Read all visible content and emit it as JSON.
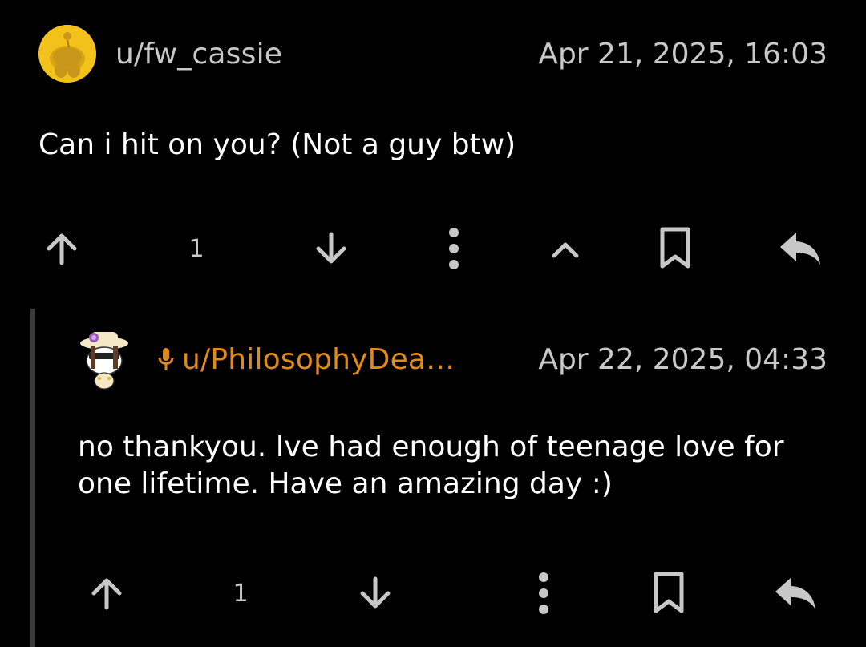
{
  "comments": [
    {
      "username": "u/fw_cassie",
      "timestamp": "Apr 21, 2025, 16:03",
      "body": "Can i hit on you? (Not a guy btw)",
      "score": "1",
      "avatar_icon": "snoo-avatar-icon",
      "has_collapse": true
    },
    {
      "username": "u/PhilosophyDea…",
      "timestamp": "Apr 22, 2025, 04:33",
      "body": "no thankyou. Ive had enough of teenage love for one lifetime. Have an amazing day :)",
      "score": "1",
      "avatar_icon": "snoo-avatar-icon",
      "badge_icon": "microphone-icon",
      "has_collapse": false
    }
  ],
  "colors": {
    "background": "#000000",
    "op_username": "#c8c8c8",
    "reply_username": "#e08a1a",
    "icon": "#c8c8c8",
    "thread_line": "#3a3a3a"
  }
}
